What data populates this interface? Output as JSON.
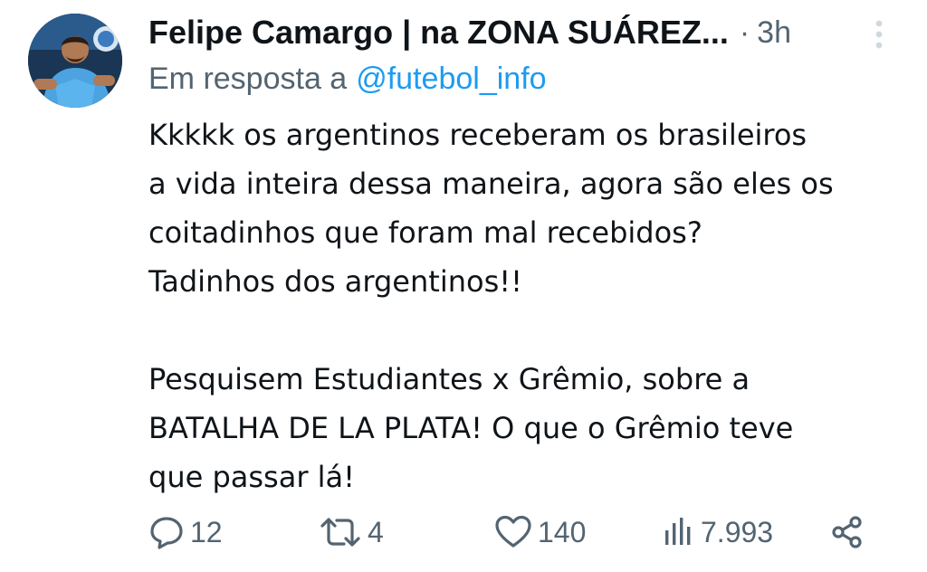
{
  "tweet": {
    "author_name": "Felipe Camargo | na ZONA SUÁREZ...",
    "separator": "·",
    "time": "3h",
    "reply_prefix": "Em resposta a",
    "reply_handle": "@futebol_info",
    "body_lines": [
      "Kkkkk os argentinos receberam os brasileiros",
      "a vida inteira dessa maneira, agora são eles os",
      "coitadinhos que foram mal recebidos?",
      "Tadinhos dos argentinos!!",
      "",
      "Pesquisem Estudiantes x Grêmio, sobre a",
      "BATALHA DE LA PLATA! O que o Grêmio teve",
      "que passar lá!"
    ],
    "actions": {
      "replies": "12",
      "retweets": "4",
      "likes": "140",
      "views": "7.993"
    },
    "icons": {
      "more": "more-vertical-icon",
      "reply": "reply-bubble-icon",
      "retweet": "retweet-icon",
      "like": "heart-icon",
      "views": "views-chart-icon",
      "share": "share-icon"
    },
    "colors": {
      "text": "#0f1419",
      "muted": "#536471",
      "link": "#1d9bf0",
      "more_dots": "#cfd9de"
    }
  }
}
